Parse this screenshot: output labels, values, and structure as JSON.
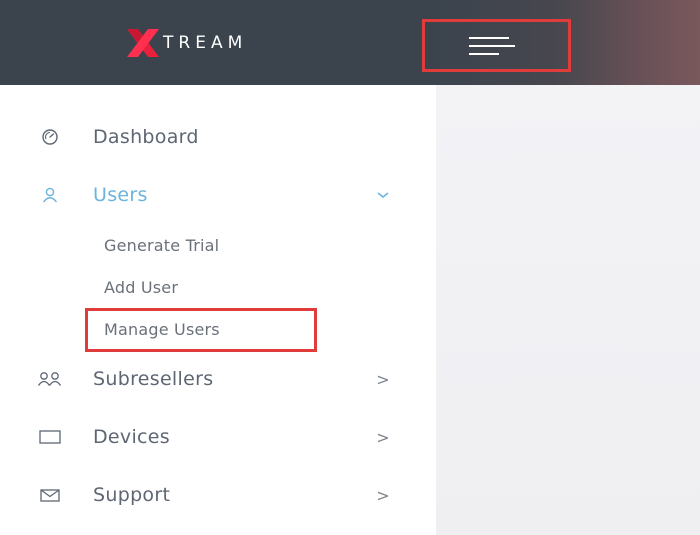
{
  "header": {
    "logo_text": "TREAM",
    "logo_accent_color": "#e8203c",
    "toggle_icon": "hamburger-icon"
  },
  "sidebar": {
    "items": [
      {
        "label": "Dashboard",
        "icon": "gauge-icon",
        "arrow": ""
      },
      {
        "label": "Users",
        "icon": "user-icon",
        "arrow": "chevron-down-icon",
        "active": true,
        "subitems": [
          {
            "label": "Generate Trial"
          },
          {
            "label": "Add User"
          },
          {
            "label": "Manage Users"
          }
        ]
      },
      {
        "label": "Subresellers",
        "icon": "users-icon",
        "arrow": ">"
      },
      {
        "label": "Devices",
        "icon": "monitor-icon",
        "arrow": ">"
      },
      {
        "label": "Support",
        "icon": "envelope-icon",
        "arrow": ">"
      }
    ]
  },
  "colors": {
    "topbar": "#3b444d",
    "active": "#6ab4dd",
    "text": "#5e6673",
    "highlight": "#e03c3c"
  }
}
